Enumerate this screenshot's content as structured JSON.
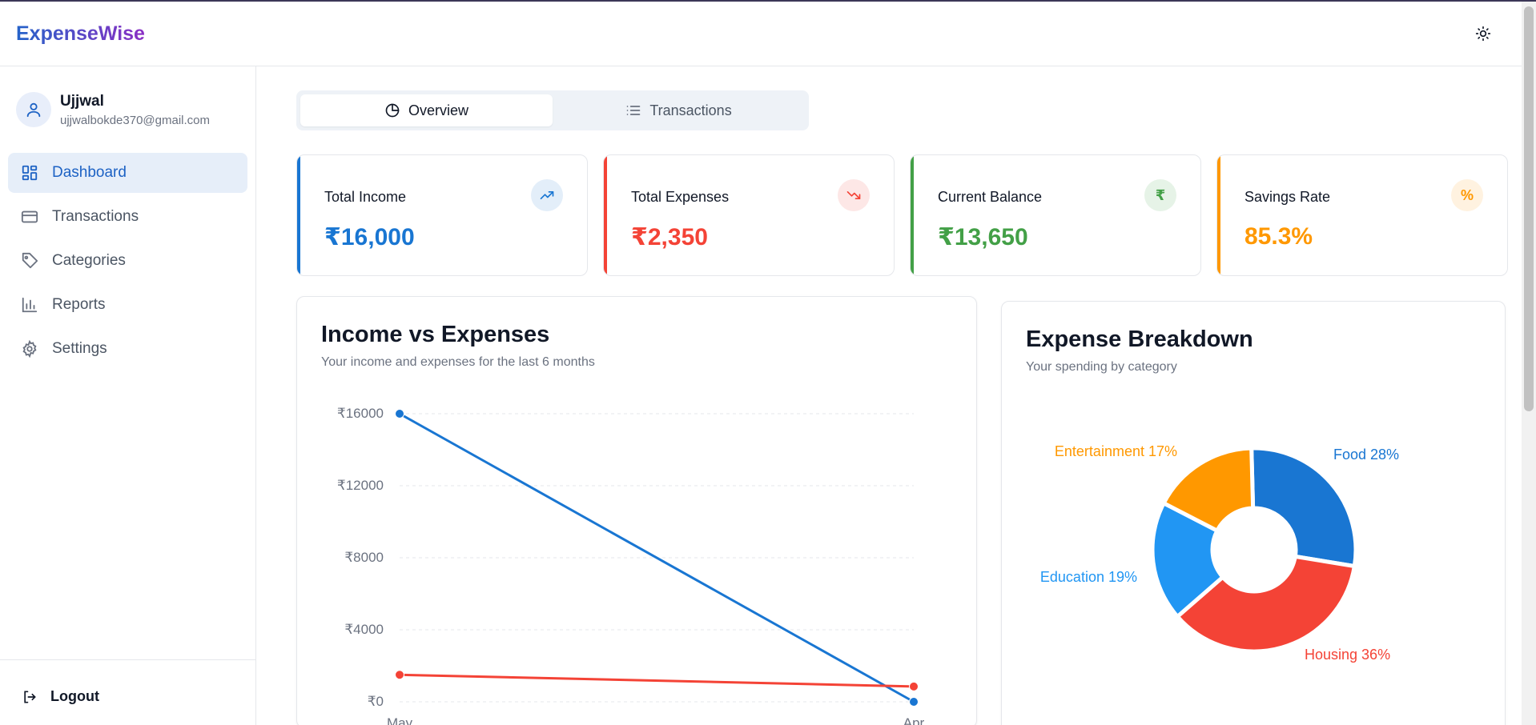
{
  "app": {
    "name": "ExpenseWise"
  },
  "header": {
    "theme_icon": "sun-icon"
  },
  "user": {
    "name": "Ujjwal",
    "email": "ujjwalbokde370@gmail.com"
  },
  "sidebar": {
    "items": [
      {
        "label": "Dashboard",
        "icon": "dashboard-icon",
        "active": true
      },
      {
        "label": "Transactions",
        "icon": "credit-card-icon",
        "active": false
      },
      {
        "label": "Categories",
        "icon": "tag-icon",
        "active": false
      },
      {
        "label": "Reports",
        "icon": "bar-chart-icon",
        "active": false
      },
      {
        "label": "Settings",
        "icon": "gear-icon",
        "active": false
      }
    ],
    "logout_label": "Logout"
  },
  "tabs": [
    {
      "label": "Overview",
      "icon": "pie-chart-icon",
      "active": true
    },
    {
      "label": "Transactions",
      "icon": "list-icon",
      "active": false
    }
  ],
  "cards": [
    {
      "label": "Total Income",
      "value": "₹16,000",
      "color": "#1976d2",
      "icon": "trending-up-icon"
    },
    {
      "label": "Total Expenses",
      "value": "₹2,350",
      "color": "#f44336",
      "icon": "trending-down-icon"
    },
    {
      "label": "Current Balance",
      "value": "₹13,650",
      "color": "#43a047",
      "icon": "rupee-icon",
      "symbol": "₹"
    },
    {
      "label": "Savings Rate",
      "value": "85.3%",
      "color": "#ff9800",
      "icon": "percent-icon",
      "symbol": "%"
    }
  ],
  "income_panel": {
    "title": "Income vs Expenses",
    "subtitle": "Your income and expenses for the last 6 months"
  },
  "breakdown_panel": {
    "title": "Expense Breakdown",
    "subtitle": "Your spending by category"
  },
  "chart_data": [
    {
      "type": "line",
      "x": [
        "May",
        "Apr"
      ],
      "series": [
        {
          "values": [
            16000,
            0
          ],
          "color": "#1976d2"
        },
        {
          "values": [
            1500,
            850
          ],
          "color": "#f44336"
        }
      ],
      "yticks": [
        0,
        4000,
        8000,
        12000,
        16000
      ],
      "ytick_labels": [
        "₹0",
        "₹4000",
        "₹8000",
        "₹12000",
        "₹16000"
      ],
      "ylim": [
        0,
        16000
      ],
      "grid": true
    },
    {
      "type": "pie",
      "donut": true,
      "categories": [
        "Food",
        "Housing",
        "Education",
        "Entertainment"
      ],
      "labels": [
        "Food 28%",
        "Housing 36%",
        "Education 19%",
        "Entertainment 17%"
      ],
      "values": [
        28,
        36,
        19,
        17
      ],
      "colors": [
        "#1976d2",
        "#f44336",
        "#2196f3",
        "#ff9800"
      ]
    }
  ]
}
